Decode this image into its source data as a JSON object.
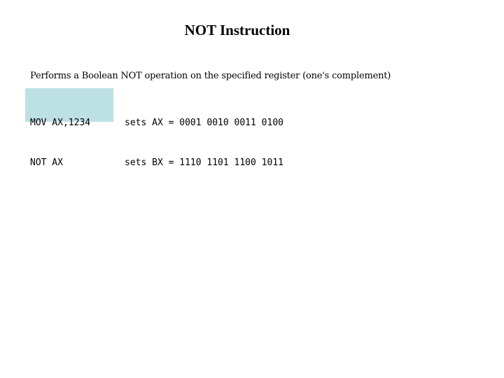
{
  "slide": {
    "title": "NOT Instruction",
    "description": "Performs a Boolean NOT operation on the specified register (one's complement)",
    "code": [
      "MOV AX,1234",
      "NOT AX"
    ],
    "results": [
      "sets AX = 0001 0010 0011 0100",
      "sets BX = 1110 1101 1100 1011"
    ],
    "colors": {
      "code_background": "#bde0e3"
    }
  }
}
